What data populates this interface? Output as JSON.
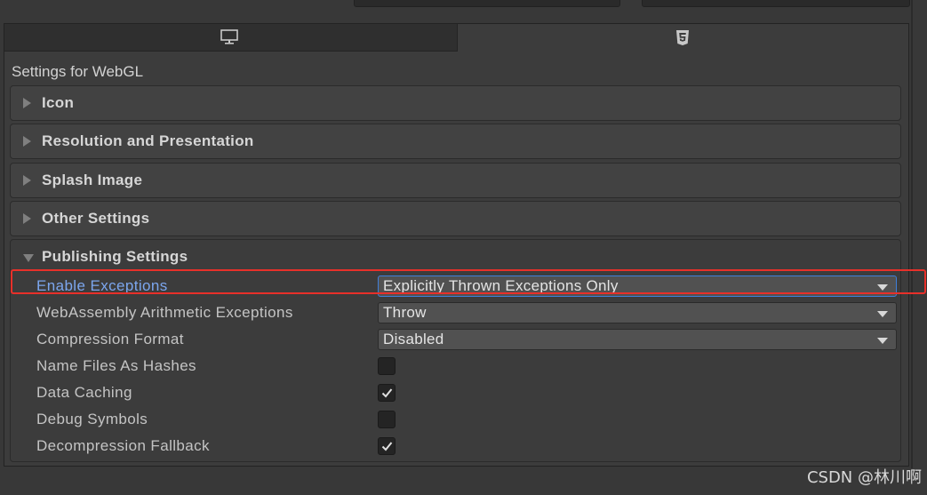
{
  "top_strip": {
    "cut_label": "· · · · · ·"
  },
  "tabs": [
    {
      "name": "Standalone",
      "icon": "monitor-icon",
      "active": false
    },
    {
      "name": "WebGL",
      "icon": "html5-icon",
      "active": true
    }
  ],
  "header": {
    "settings_for": "Settings for WebGL"
  },
  "sections": [
    {
      "title": "Icon"
    },
    {
      "title": "Resolution and Presentation"
    },
    {
      "title": "Splash Image"
    },
    {
      "title": "Other Settings"
    }
  ],
  "publishing": {
    "title": "Publishing Settings",
    "enable_exceptions": {
      "label": "Enable Exceptions",
      "value": "Explicitly Thrown Exceptions Only"
    },
    "wasm_arith": {
      "label": "WebAssembly Arithmetic Exceptions",
      "value": "Throw"
    },
    "compression": {
      "label": "Compression Format",
      "value": "Disabled"
    },
    "name_files": {
      "label": "Name Files As Hashes",
      "checked": false
    },
    "data_caching": {
      "label": "Data Caching",
      "checked": true
    },
    "debug_symbols": {
      "label": "Debug Symbols",
      "checked": false
    },
    "decompression": {
      "label": "Decompression Fallback",
      "checked": true
    }
  },
  "watermark": "CSDN @林川啊",
  "colors": {
    "accent_label": "#7ca6ee",
    "highlight_border": "#e8302a",
    "focus_border": "#3f7fd9"
  }
}
